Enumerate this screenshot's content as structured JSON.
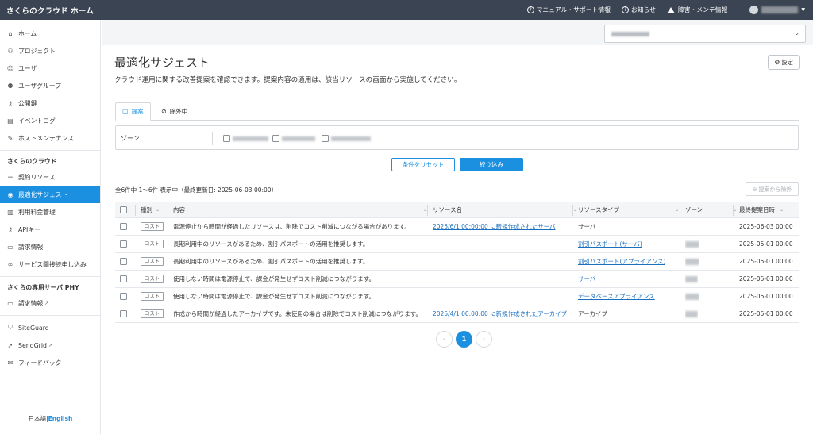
{
  "app": {
    "title": "さくらのクラウド ホーム",
    "top_nav": [
      {
        "icon": "help-circle-icon",
        "label": "マニュアル・サポート情報"
      },
      {
        "icon": "info-circle-icon",
        "label": "お知らせ"
      },
      {
        "icon": "warning-triangle-icon",
        "label": "障害・メンテ情報"
      }
    ]
  },
  "sidebar": {
    "group1": [
      {
        "icon": "home-icon",
        "label": "ホーム"
      },
      {
        "icon": "project-icon",
        "label": "プロジェクト"
      },
      {
        "icon": "user-icon",
        "label": "ユーザ"
      },
      {
        "icon": "user-group-icon",
        "label": "ユーザグループ"
      },
      {
        "icon": "key-icon",
        "label": "公開鍵"
      },
      {
        "icon": "event-log-icon",
        "label": "イベントログ"
      },
      {
        "icon": "wrench-icon",
        "label": "ホストメンテナンス"
      }
    ],
    "section2_title": "さくらのクラウド",
    "group2": [
      {
        "icon": "list-icon",
        "label": "契約リソース"
      },
      {
        "icon": "lightbulb-icon",
        "label": "最適化サジェスト",
        "active": true
      },
      {
        "icon": "bar-chart-icon",
        "label": "利用料金管理"
      },
      {
        "icon": "key-icon",
        "label": "APIキー"
      },
      {
        "icon": "receipt-icon",
        "label": "請求情報"
      },
      {
        "icon": "link-icon",
        "label": "サービス間接続申し込み"
      }
    ],
    "section3_title": "さくらの専用サーバ PHY",
    "group3": [
      {
        "icon": "receipt-icon",
        "label": "請求情報",
        "external": true
      }
    ],
    "group4": [
      {
        "icon": "shield-icon",
        "label": "SiteGuard"
      },
      {
        "icon": "send-icon",
        "label": "SendGrid",
        "external": true
      },
      {
        "icon": "feedback-icon",
        "label": "フィードバック"
      }
    ],
    "lang_ja": "日本語",
    "lang_sep": "|",
    "lang_en": "English"
  },
  "page": {
    "title": "最適化サジェスト",
    "settings_label": "設定",
    "description": "クラウド運用に関する改善提案を確認できます。提案内容の適用は、該当リソースの画面から実施してください。"
  },
  "tabs": [
    {
      "icon": "chat-icon",
      "label": "提案",
      "active": true
    },
    {
      "icon": "hidden-icon",
      "label": "除外中",
      "active": false
    }
  ],
  "filter": {
    "zone_label": "ゾーン",
    "reset_label": "条件をリセット",
    "apply_label": "絞り込み"
  },
  "results": {
    "count_text": "全6件中 1〜6件 表示中（最終更新日: 2025-06-03 00:00）",
    "exclude_label": "提案から除外"
  },
  "table": {
    "headers": [
      "種別",
      "内容",
      "リソース名",
      "リソースタイプ",
      "ゾーン",
      "最終提案日時"
    ],
    "rows": [
      {
        "type": "コスト",
        "content": "電源停止から時間が経過したリソースは、削除でコスト削減につながる場合があります。",
        "resource": "2025/6/1 00:00:00 に新規作成されたサーバ",
        "resource_type": "サーバ",
        "resource_type_link": false,
        "zone_hidden": false,
        "date": "2025-06-03 00:00"
      },
      {
        "type": "コスト",
        "content": "長期利用中のリソースがあるため、割引パスポートの活用を推奨します。",
        "resource": "",
        "resource_type": "割引パスポート(サーバ)",
        "resource_type_link": true,
        "zone_hidden": true,
        "date": "2025-05-01 00:00"
      },
      {
        "type": "コスト",
        "content": "長期利用中のリソースがあるため、割引パスポートの活用を推奨します。",
        "resource": "",
        "resource_type": "割引パスポート(アプライアンス)",
        "resource_type_link": true,
        "zone_hidden": true,
        "date": "2025-05-01 00:00"
      },
      {
        "type": "コスト",
        "content": "使用しない時間は電源停止で、課金が発生せずコスト削減につながります。",
        "resource": "",
        "resource_type": "サーバ",
        "resource_type_link": true,
        "zone_hidden": true,
        "date": "2025-05-01 00:00"
      },
      {
        "type": "コスト",
        "content": "使用しない時間は電源停止で、課金が発生せずコスト削減につながります。",
        "resource": "",
        "resource_type": "データベースアプライアンス",
        "resource_type_link": true,
        "zone_hidden": true,
        "date": "2025-05-01 00:00"
      },
      {
        "type": "コスト",
        "content": "作成から時間が経過したアーカイブです。未使用の場合は削除でコスト削減につながります。",
        "resource": "2025/4/1 00:00:00 に新規作成されたアーカイブ",
        "resource_type": "アーカイブ",
        "resource_type_link": false,
        "zone_hidden": true,
        "date": "2025-05-01 00:00"
      }
    ]
  },
  "pagination": {
    "prev": "‹",
    "current": "1",
    "next": "›"
  },
  "colors": {
    "accent": "#1b8fe0",
    "topbar": "#3b4452",
    "link": "#1b6fbf"
  }
}
